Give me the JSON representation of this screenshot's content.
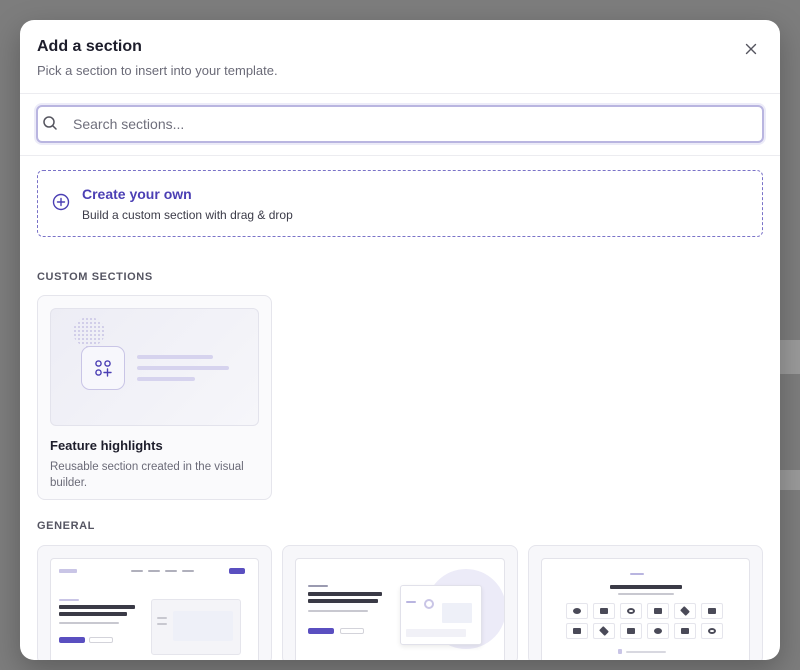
{
  "modal": {
    "title": "Add a section",
    "subtitle": "Pick a section to insert into your template."
  },
  "search": {
    "placeholder": "Search sections..."
  },
  "create": {
    "title": "Create your own",
    "subtitle": "Build a custom section with drag & drop"
  },
  "custom_sections": {
    "label": "CUSTOM SECTIONS",
    "items": [
      {
        "title": "Feature highlights",
        "description": "Reusable section created in the visual builder."
      }
    ]
  },
  "general": {
    "label": "GENERAL"
  },
  "colors": {
    "accent": "#4b3fb4",
    "accent_light": "#d6d3ee"
  }
}
